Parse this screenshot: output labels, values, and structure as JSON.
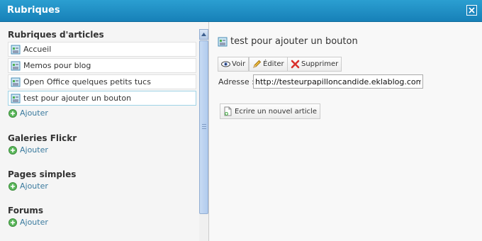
{
  "window": {
    "title": "Rubriques"
  },
  "left": {
    "sections": [
      {
        "title": "Rubriques d'articles"
      },
      {
        "title": "Galeries Flickr"
      },
      {
        "title": "Pages simples"
      },
      {
        "title": "Forums"
      }
    ],
    "articles": [
      {
        "label": "Accueil"
      },
      {
        "label": "Memos pour blog"
      },
      {
        "label": "Open Office quelques petits tucs"
      },
      {
        "label": "test pour ajouter un bouton"
      }
    ],
    "add_label": "Ajouter"
  },
  "right": {
    "title": "test pour ajouter un bouton",
    "buttons": {
      "view": "Voir",
      "edit": "Éditer",
      "delete": "Supprimer"
    },
    "address_label": "Adresse :",
    "address_value": "http://testeurpapilloncandide.eklablog.com",
    "new_article": "Ecrire un nouvel article"
  },
  "colors": {
    "titlebar": "#1d8ac4",
    "link": "#3a7a9e",
    "selected_border": "#9fd3e6"
  },
  "icons": [
    "close-icon",
    "document-icon",
    "add-icon",
    "eye-icon",
    "pencil-icon",
    "delete-icon",
    "new-document-icon",
    "scroll-up-icon"
  ]
}
